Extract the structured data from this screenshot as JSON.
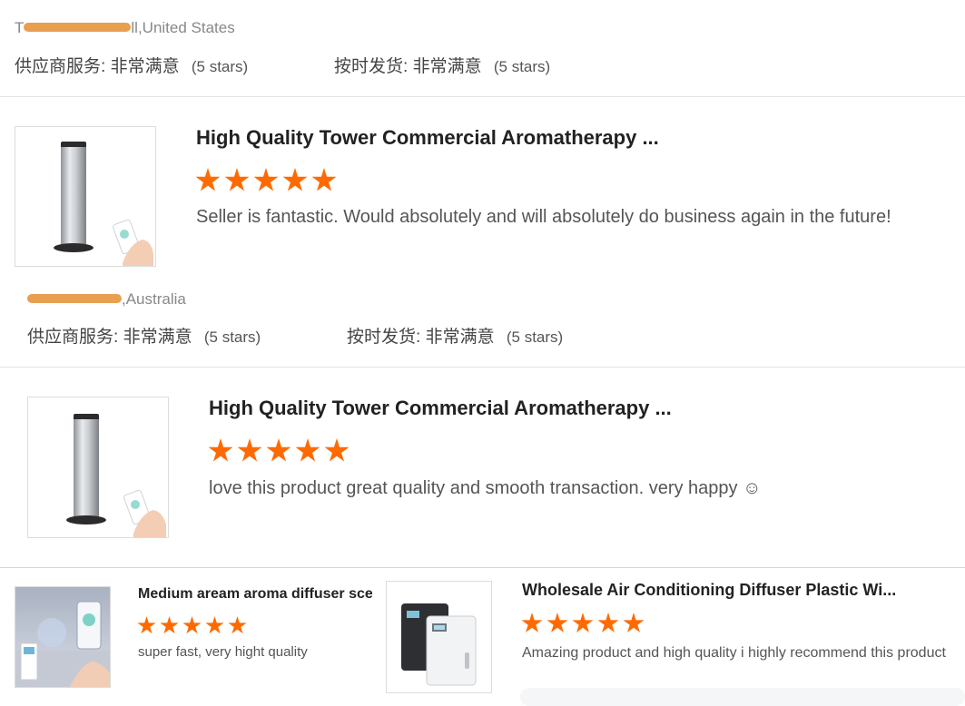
{
  "reviews": [
    {
      "location_suffix": "ll,United States",
      "location_prefix": "T",
      "supplier_service_label": "供应商服务:",
      "supplier_service_value": "非常满意",
      "supplier_service_stars": "(5 stars)",
      "shipping_label": "按时发货:",
      "shipping_value": "非常满意",
      "shipping_stars": "(5 stars)"
    },
    {
      "product_title": "High Quality Tower Commercial Aromatherapy ...",
      "rating": 5,
      "review_text": "Seller is fantastic.  Would absolutely and will absolutely do business again in the future!",
      "location_suffix": ",Australia",
      "supplier_service_label": "供应商服务:",
      "supplier_service_value": "非常满意",
      "supplier_service_stars": "(5 stars)",
      "shipping_label": "按时发货:",
      "shipping_value": "非常满意",
      "shipping_stars": "(5 stars)"
    },
    {
      "product_title": "High Quality Tower Commercial Aromatherapy ...",
      "rating": 5,
      "review_text": "love this product great quality and smooth transaction. very happy ☺"
    }
  ],
  "related": [
    {
      "title": "Medium aream aroma diffuser scen",
      "rating": 5,
      "review_text": "super fast, very hight quality"
    },
    {
      "title": "Wholesale Air Conditioning Diffuser Plastic Wi...",
      "rating": 5,
      "review_text": "Amazing product and high quality i highly recommend this product"
    }
  ],
  "icons": {
    "star": "star-icon",
    "product": "tower-diffuser-image",
    "phone": "phone-app-image"
  },
  "colors": {
    "star": "#ff6a00",
    "redaction": "#e8a050"
  }
}
